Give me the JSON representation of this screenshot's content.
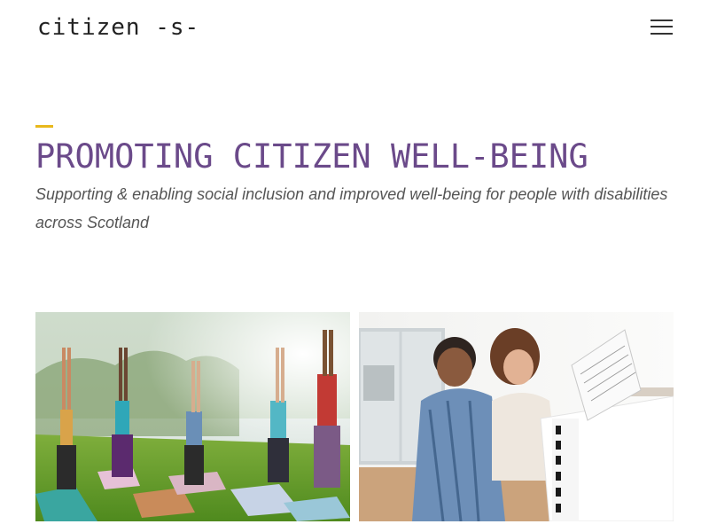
{
  "header": {
    "logo_text": "citizen -s-",
    "menu_icon": "hamburger-menu-icon"
  },
  "hero": {
    "title": "PROMOTING CITIZEN WELL-BEING",
    "subtitle": "Supporting & enabling social inclusion and improved well-being for people with disabilities across Scotland"
  },
  "colors": {
    "title": "#6b4a8a",
    "accent": "#e8b81c",
    "text": "#555555"
  },
  "gallery": {
    "items": [
      {
        "name": "yoga-group-photo"
      },
      {
        "name": "piano-lesson-photo"
      }
    ]
  }
}
